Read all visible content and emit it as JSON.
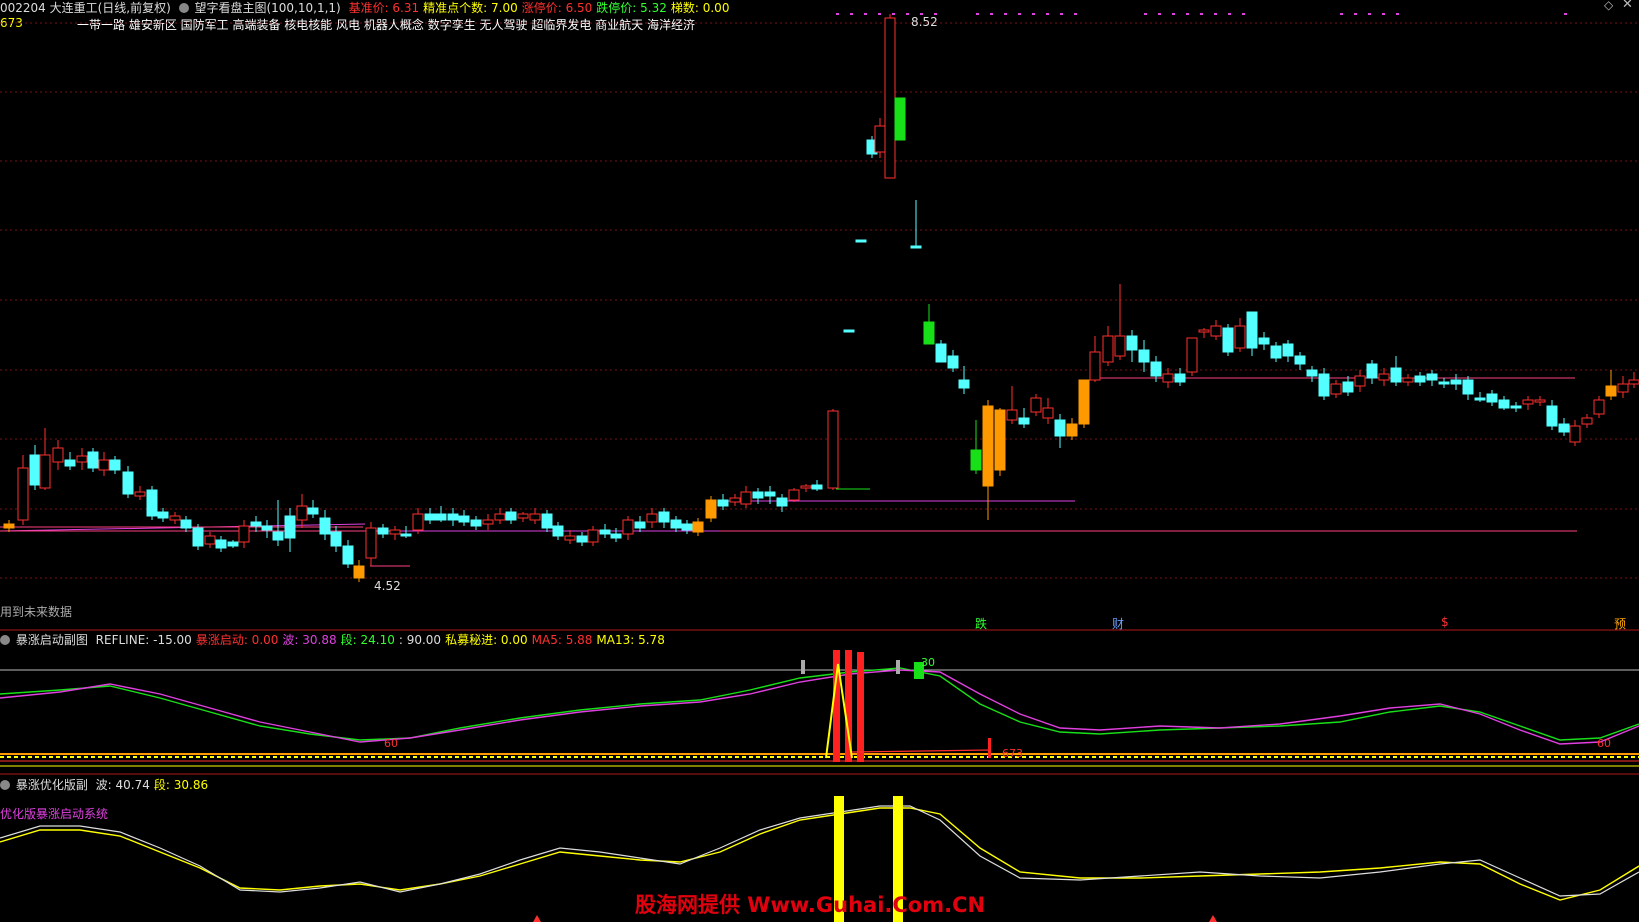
{
  "header": {
    "code_title": "002204 大连重工(日线,前复权)",
    "indicator": "望字看盘主图(100,10,1,1)",
    "items": [
      {
        "label": "基准价",
        "value": "6.31",
        "color": "#ff3030"
      },
      {
        "label": "精准点个数",
        "value": "7.00",
        "color": "#ffff00"
      },
      {
        "label": "涨停价",
        "value": "6.50",
        "color": "#ff3030"
      },
      {
        "label": "跌停价",
        "value": "5.32",
        "color": "#30ff30"
      },
      {
        "label": "梯数",
        "value": "0.00",
        "color": "#ffff00"
      }
    ],
    "left_value": "673",
    "concepts": "一带一路 雄安新区 国防军工 高端装备 核电核能 风电 机器人概念 数字孪生 无人驾驶 超临界发电 商业航天 海洋经济"
  },
  "main_chart": {
    "high_label": "8.52",
    "low_label": "4.52",
    "future_note": "用到未来数据",
    "markers": [
      {
        "text": "跌",
        "color": "#30ff30"
      },
      {
        "text": "财",
        "color": "#6aa0ff"
      },
      {
        "text": "$",
        "color": "#ff3030"
      },
      {
        "text": "预",
        "color": "#ffaa00"
      }
    ]
  },
  "sub1": {
    "title": "暴涨启动副图",
    "items": [
      {
        "label": "REFLINE",
        "value": "-15.00",
        "color": "#dddddd"
      },
      {
        "label": "暴涨启动",
        "value": "0.00",
        "color": "#ff3030"
      },
      {
        "label": "波",
        "value": "30.88",
        "color": "#e040e0"
      },
      {
        "label": "段",
        "value": "24.10",
        "color": "#30ff30"
      },
      {
        "label": "",
        "value": "90.00",
        "color": "#dddddd"
      },
      {
        "label": "私募秘进",
        "value": "0.00",
        "color": "#ffff00"
      },
      {
        "label": "MA5",
        "value": "5.88",
        "color": "#ff3030"
      },
      {
        "label": "MA13",
        "value": "5.78",
        "color": "#ffff00"
      }
    ],
    "label_60_left": "60",
    "label_60_right": "60",
    "label_30": "30",
    "label_673": "673"
  },
  "sub2": {
    "title": "暴涨优化版副",
    "items": [
      {
        "label": "波",
        "value": "40.74",
        "color": "#dddddd"
      },
      {
        "label": "段",
        "value": "30.86",
        "color": "#ffff00"
      }
    ],
    "system_label": "优化版暴涨启动系统"
  },
  "watermark": "股海网提供 Www.Guhai.Com.CN",
  "colors": {
    "up": "#ff3030",
    "down": "#54ffff",
    "accent": "#ff9900",
    "green": "#18e018"
  }
}
